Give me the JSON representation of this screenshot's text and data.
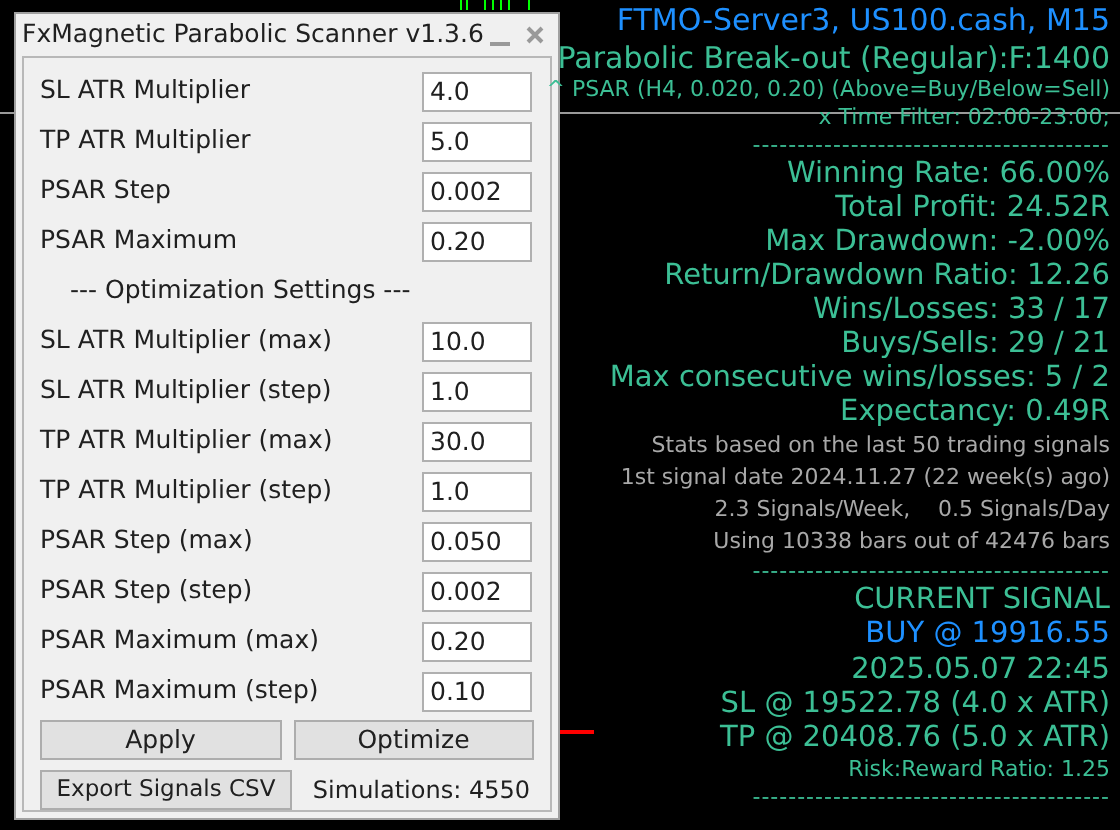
{
  "dialog": {
    "title": "FxMagnetic Parabolic Scanner v1.3.6",
    "fields": [
      {
        "kind": "field",
        "label": "SL ATR Multiplier",
        "value": "4.0"
      },
      {
        "kind": "field",
        "label": "TP ATR Multiplier",
        "value": "5.0"
      },
      {
        "kind": "field",
        "label": "PSAR Step",
        "value": "0.002"
      },
      {
        "kind": "field",
        "label": "PSAR Maximum",
        "value": "0.20"
      },
      {
        "kind": "heading",
        "label": "--- Optimization Settings ---"
      },
      {
        "kind": "field",
        "label": "SL ATR Multiplier (max)",
        "value": "10.0"
      },
      {
        "kind": "field",
        "label": "SL ATR Multiplier (step)",
        "value": "1.0"
      },
      {
        "kind": "field",
        "label": "TP ATR Multiplier (max)",
        "value": "30.0"
      },
      {
        "kind": "field",
        "label": "TP ATR Multiplier (step)",
        "value": "1.0"
      },
      {
        "kind": "field",
        "label": "PSAR Step (max)",
        "value": "0.050"
      },
      {
        "kind": "field",
        "label": "PSAR Step (step)",
        "value": "0.002"
      },
      {
        "kind": "field",
        "label": "PSAR Maximum (max)",
        "value": "0.20"
      },
      {
        "kind": "field",
        "label": "PSAR Maximum (step)",
        "value": "0.10"
      }
    ],
    "buttons": [
      "Apply",
      "Optimize"
    ],
    "export_button": "Export Signals CSV",
    "simulations": "Simulations: 4550"
  },
  "stats_panel": [
    {
      "kind": "title",
      "text": "FTMO-Server3, US100.cash, M15"
    },
    {
      "kind": "subtitle",
      "text": "Parabolic Break-out (Regular):F:1400"
    },
    {
      "kind": "note",
      "text": "^ PSAR (H4, 0.020, 0.20) (Above=Buy/Below=Sell)"
    },
    {
      "kind": "note",
      "text": "x Time Filter: 02:00-23:00;"
    },
    {
      "kind": "divider",
      "text": "----------------------------------------"
    },
    {
      "kind": "stat",
      "text": "Winning Rate: 66.00%"
    },
    {
      "kind": "stat",
      "text": "Total Profit: 24.52R"
    },
    {
      "kind": "stat",
      "text": "Max Drawdown: -2.00%"
    },
    {
      "kind": "stat",
      "text": "Return/Drawdown Ratio: 12.26"
    },
    {
      "kind": "stat",
      "text": "Wins/Losses: 33 / 17"
    },
    {
      "kind": "stat",
      "text": "Buys/Sells: 29 / 21"
    },
    {
      "kind": "stat",
      "text": "Max consecutive wins/losses: 5 / 2"
    },
    {
      "kind": "stat",
      "text": "Expectancy: 0.49R"
    },
    {
      "kind": "info",
      "text": "Stats based on the last 50 trading signals"
    },
    {
      "kind": "info",
      "text": "1st signal date 2024.11.27 (22 week(s) ago)"
    },
    {
      "kind": "info",
      "text": "2.3 Signals/Week,    0.5 Signals/Day"
    },
    {
      "kind": "info",
      "text": "Using 10338 bars out of 42476 bars"
    },
    {
      "kind": "divider",
      "text": "----------------------------------------"
    },
    {
      "kind": "stat",
      "text": "CURRENT SIGNAL"
    },
    {
      "kind": "signal",
      "text": "BUY @ 19916.55"
    },
    {
      "kind": "stat",
      "text": "2025.05.07 22:45"
    },
    {
      "kind": "stat",
      "text": "SL @ 19522.78 (4.0 x ATR)"
    },
    {
      "kind": "stat",
      "text": "TP @ 20408.76 (5.0 x ATR)"
    },
    {
      "kind": "note",
      "text": "Risk:Reward Ratio: 1.25"
    },
    {
      "kind": "divider",
      "text": "----------------------------------------"
    }
  ]
}
